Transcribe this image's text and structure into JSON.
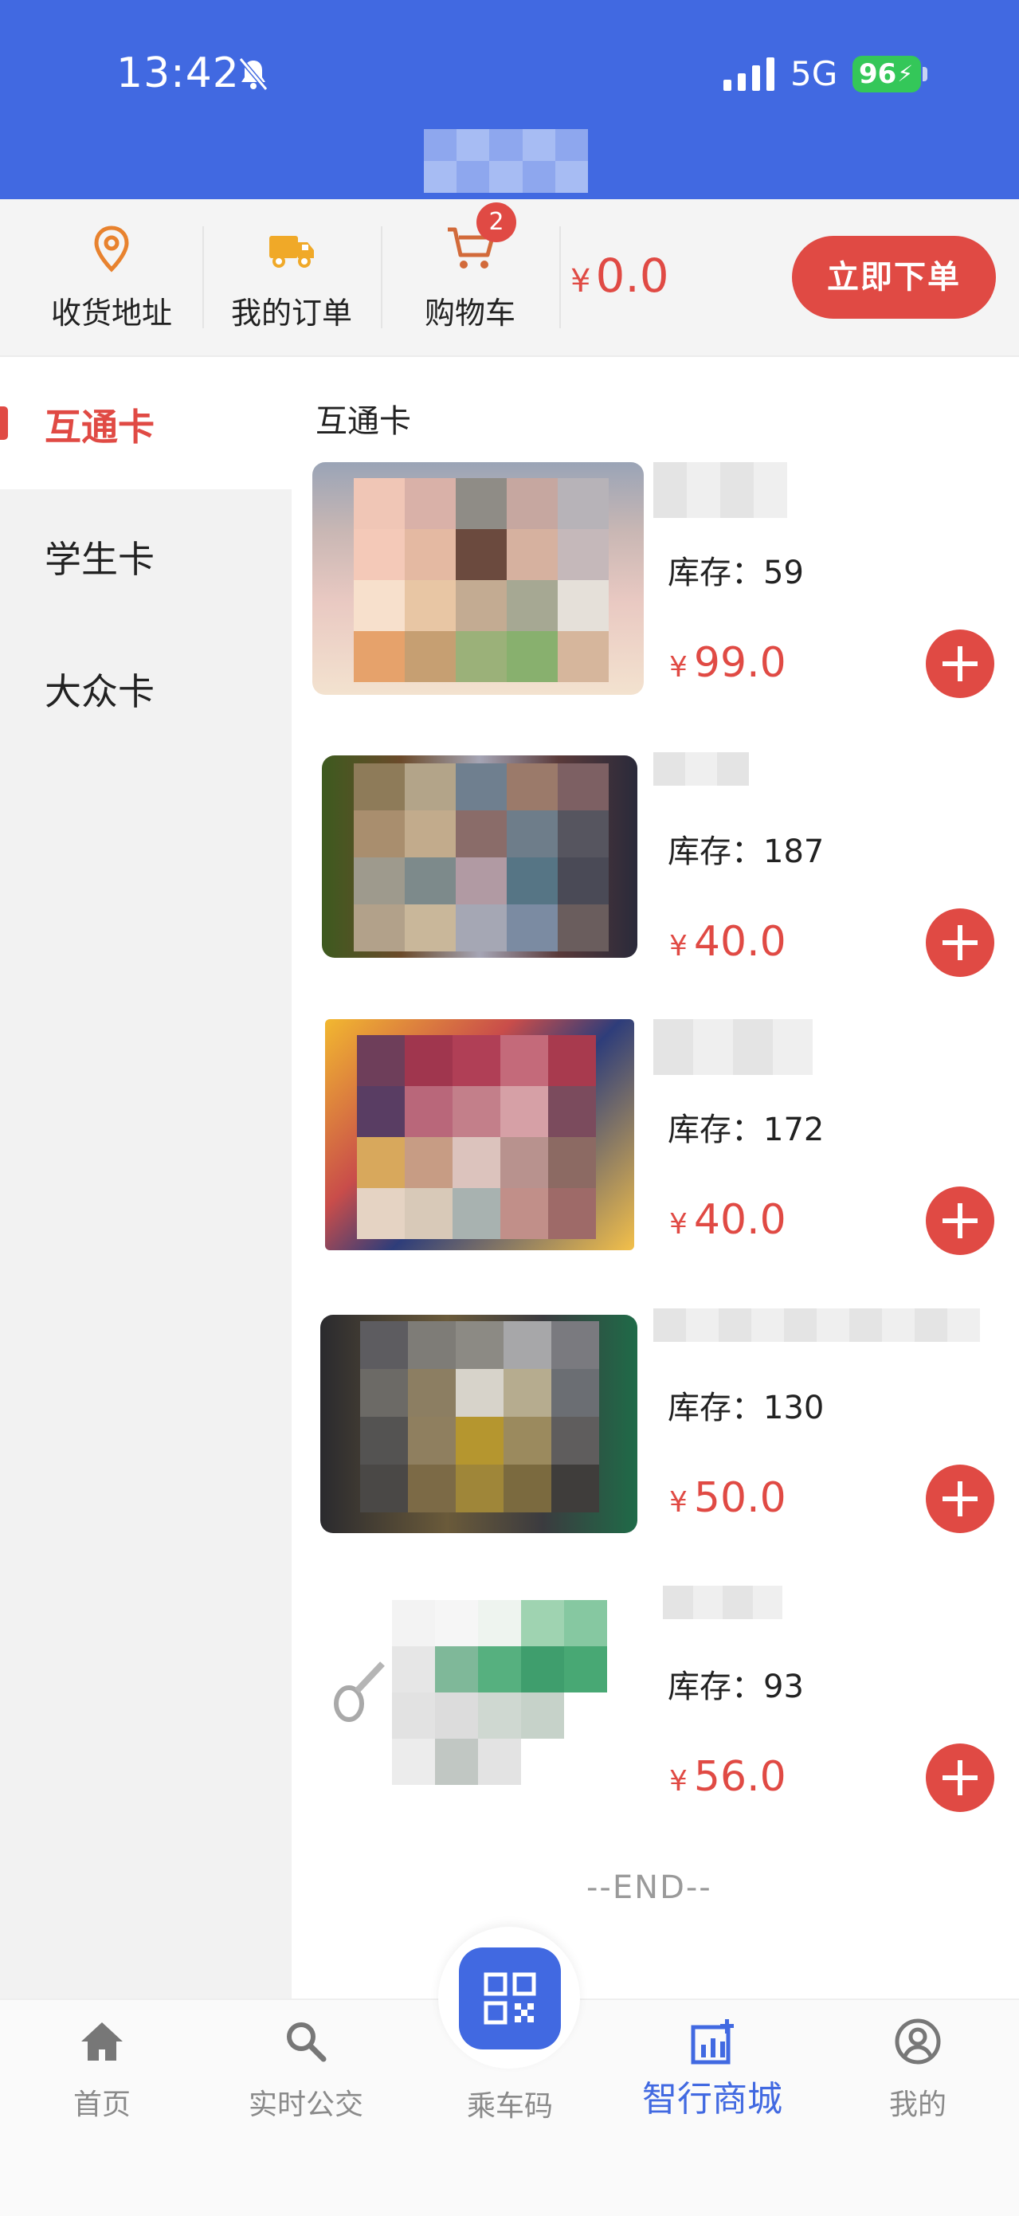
{
  "status_bar": {
    "time": "13:42",
    "network": "5G",
    "battery": "96"
  },
  "colors": {
    "brand": "#4169E1",
    "accent": "#E04A44",
    "bg_sidebar": "#F2F2F2"
  },
  "toolbar": {
    "address_label": "收货地址",
    "orders_label": "我的订单",
    "cart_label": "购物车",
    "cart_badge": "2",
    "currency": "¥",
    "total": "0.0",
    "order_button": "立即下单"
  },
  "sidebar": {
    "items": [
      {
        "label": "互通卡",
        "active": true
      },
      {
        "label": "学生卡",
        "active": false
      },
      {
        "label": "大众卡",
        "active": false
      }
    ]
  },
  "section_title": "互通卡",
  "products": [
    {
      "stock": "库存：59",
      "price": "99.0"
    },
    {
      "stock": "库存：187",
      "price": "40.0"
    },
    {
      "stock": "库存：172",
      "price": "40.0"
    },
    {
      "stock": "库存：130",
      "price": "50.0"
    },
    {
      "stock": "库存：93",
      "price": "56.0"
    }
  ],
  "end_text": "--END--",
  "bottom_nav": {
    "home": "首页",
    "bus": "实时公交",
    "qr": "乘车码",
    "mall": "智行商城",
    "me": "我的"
  },
  "icons": [
    "bell-muted-icon",
    "signal-icon",
    "location-pin-icon",
    "truck-icon",
    "cart-icon",
    "home-icon",
    "search-icon",
    "qr-code-icon",
    "mall-chart-icon",
    "user-icon",
    "plus-icon"
  ]
}
